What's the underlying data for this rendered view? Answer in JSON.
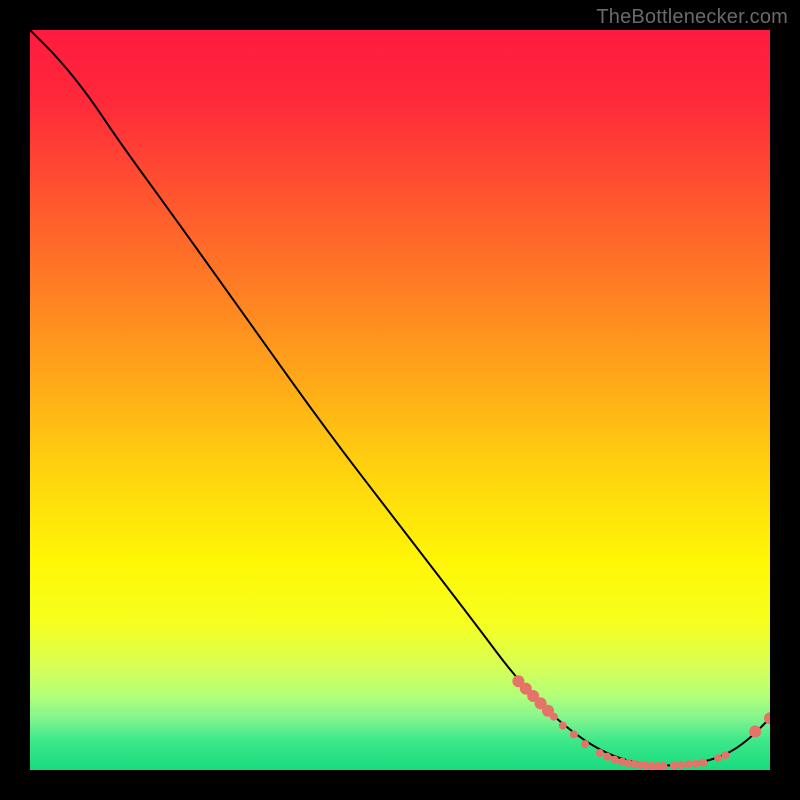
{
  "watermark": "TheBottlenecker.com",
  "chart_data": {
    "type": "line",
    "title": "",
    "xlabel": "",
    "ylabel": "",
    "xlim": [
      0,
      100
    ],
    "ylim": [
      0,
      100
    ],
    "background_gradient": {
      "stops": [
        {
          "offset": 0.0,
          "color": "#ff1a3f"
        },
        {
          "offset": 0.1,
          "color": "#ff2a3a"
        },
        {
          "offset": 0.22,
          "color": "#ff5330"
        },
        {
          "offset": 0.35,
          "color": "#ff7e24"
        },
        {
          "offset": 0.48,
          "color": "#ffab18"
        },
        {
          "offset": 0.6,
          "color": "#ffd40e"
        },
        {
          "offset": 0.72,
          "color": "#fff706"
        },
        {
          "offset": 0.8,
          "color": "#f6ff1e"
        },
        {
          "offset": 0.86,
          "color": "#d8ff55"
        },
        {
          "offset": 0.9,
          "color": "#b2ff7a"
        },
        {
          "offset": 0.93,
          "color": "#82f58e"
        },
        {
          "offset": 0.96,
          "color": "#3de88a"
        },
        {
          "offset": 1.0,
          "color": "#17db7e"
        }
      ]
    },
    "series": [
      {
        "name": "bottleneck-curve",
        "color": "#000000",
        "points": [
          {
            "x": 0,
            "y": 100
          },
          {
            "x": 4,
            "y": 96
          },
          {
            "x": 8,
            "y": 91
          },
          {
            "x": 12,
            "y": 85
          },
          {
            "x": 20,
            "y": 74
          },
          {
            "x": 30,
            "y": 60
          },
          {
            "x": 40,
            "y": 46
          },
          {
            "x": 50,
            "y": 33
          },
          {
            "x": 60,
            "y": 20
          },
          {
            "x": 66,
            "y": 12
          },
          {
            "x": 72,
            "y": 6
          },
          {
            "x": 78,
            "y": 2
          },
          {
            "x": 84,
            "y": 0.5
          },
          {
            "x": 90,
            "y": 0.8
          },
          {
            "x": 94,
            "y": 2
          },
          {
            "x": 97,
            "y": 4
          },
          {
            "x": 100,
            "y": 7
          }
        ]
      }
    ],
    "markers": {
      "name": "sample-points",
      "color": "#e57368",
      "radius_small": 4,
      "radius_large": 6,
      "points": [
        {
          "x": 66.0,
          "y": 12.0,
          "r": "large"
        },
        {
          "x": 67.0,
          "y": 11.0,
          "r": "large"
        },
        {
          "x": 68.0,
          "y": 10.0,
          "r": "large"
        },
        {
          "x": 69.0,
          "y": 9.0,
          "r": "large"
        },
        {
          "x": 70.0,
          "y": 8.0,
          "r": "large"
        },
        {
          "x": 70.8,
          "y": 7.2,
          "r": "small"
        },
        {
          "x": 72.0,
          "y": 6.0,
          "r": "small"
        },
        {
          "x": 73.5,
          "y": 4.8,
          "r": "small"
        },
        {
          "x": 75.0,
          "y": 3.5,
          "r": "small"
        },
        {
          "x": 77.0,
          "y": 2.3,
          "r": "small"
        },
        {
          "x": 78.0,
          "y": 1.8,
          "r": "small"
        },
        {
          "x": 79.0,
          "y": 1.4,
          "r": "small"
        },
        {
          "x": 80.0,
          "y": 1.1,
          "r": "small"
        },
        {
          "x": 80.8,
          "y": 0.95,
          "r": "small"
        },
        {
          "x": 81.6,
          "y": 0.8,
          "r": "small"
        },
        {
          "x": 82.4,
          "y": 0.7,
          "r": "small"
        },
        {
          "x": 83.2,
          "y": 0.6,
          "r": "small"
        },
        {
          "x": 84.0,
          "y": 0.55,
          "r": "small"
        },
        {
          "x": 84.8,
          "y": 0.52,
          "r": "small"
        },
        {
          "x": 85.6,
          "y": 0.55,
          "r": "small"
        },
        {
          "x": 87.0,
          "y": 0.62,
          "r": "small"
        },
        {
          "x": 88.0,
          "y": 0.7,
          "r": "small"
        },
        {
          "x": 89.0,
          "y": 0.78,
          "r": "small"
        },
        {
          "x": 90.0,
          "y": 0.85,
          "r": "small"
        },
        {
          "x": 91.0,
          "y": 1.0,
          "r": "small"
        },
        {
          "x": 93.0,
          "y": 1.6,
          "r": "small"
        },
        {
          "x": 94.0,
          "y": 2.0,
          "r": "small"
        },
        {
          "x": 98.0,
          "y": 5.2,
          "r": "large"
        },
        {
          "x": 100.0,
          "y": 7.0,
          "r": "large"
        }
      ]
    }
  }
}
